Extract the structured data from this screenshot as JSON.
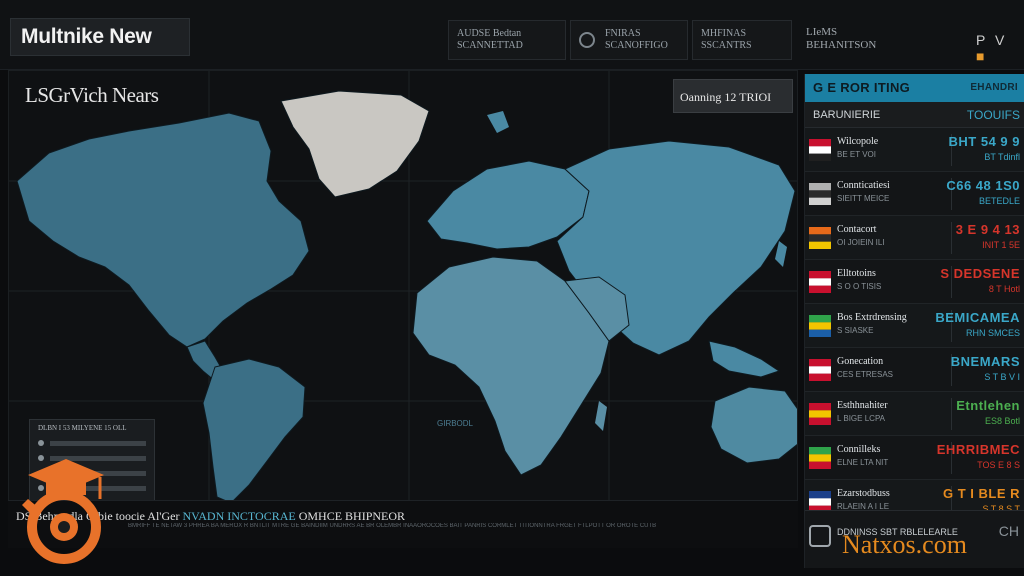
{
  "app": {
    "title": "Multnike New"
  },
  "top_tabs": [
    {
      "label": "AUDSE Bedtan\nSCANNETTAD"
    },
    {
      "label": "FNIRAS\nSCANOFFIGO"
    },
    {
      "label": "MHFINAS\nSSCANTRS"
    }
  ],
  "top_right": {
    "label": "LIeMS\nBEHANITSON",
    "pv": "P V",
    "accent": "■"
  },
  "map": {
    "title": "LSGrVich Nears",
    "badge": "Oanning 12 TRIOI",
    "center_label": "GIRBODL",
    "mini_box_header": "DLBN I 53 MILYENE 15 OLL"
  },
  "ticker": {
    "title_pre": "DS Behmadla Olbie toocie Al'Ger",
    "title_hl": "NVADN INCTOCRAE",
    "title_post": "OMHCE BHIPNEOR",
    "sub": "BMRIFF TE NETAW 3 PHREA BA MEROX R BNTLIT MTRE GE BAINDIIM UNDRRS AE BR OLEMBR INAAOROCOES BAIT PANRIS CORMLET TITIONNTRA FRGET FTLPOTT OR OROTE CUTB"
  },
  "list": {
    "header": "G E ROR ITING",
    "header_right": "EHANDRI",
    "sub_label": "BARUNIERIE",
    "sub_right": "TOOUIFS",
    "rows": [
      {
        "name": "Wilcopole",
        "meta": "BE ET VOI",
        "val": "BHT 54 9 9",
        "val2": "BT Tdinfl",
        "color": "#3aa7c8",
        "flag": [
          "#c8102e",
          "#ffffff",
          "#202020"
        ]
      },
      {
        "name": "Connticatiesi",
        "meta": "SIEITT MEICE",
        "val": "C66 48 1S0",
        "val2": "BETEDLE",
        "color": "#3aa7c8",
        "flag": [
          "#b0b0b0",
          "#2a2a2a",
          "#d0d0d0"
        ]
      },
      {
        "name": "Contacort",
        "meta": "OI JOIEIN ILI",
        "val": "3 E 9 4 13",
        "val2": "INIT 1 5E",
        "color": "#d6352b",
        "flag": [
          "#e86a1a",
          "#2b2b2b",
          "#f2c500"
        ]
      },
      {
        "name": "Elltotoins",
        "meta": "S O O TISIS",
        "val": "S DEDSENE",
        "val2": "8 T Hotl",
        "color": "#d6352b",
        "flag": [
          "#c8102e",
          "#ffffff",
          "#c8102e"
        ]
      },
      {
        "name": "Bos Extrdrensing",
        "meta": "S SIASKE",
        "val": "BEMICAMEA",
        "val2": "RHN SMCES",
        "color": "#3aa7c8",
        "flag": [
          "#2fa34a",
          "#f2c500",
          "#1b5fa8"
        ]
      },
      {
        "name": "Gonecation",
        "meta": "CES ETRESAS",
        "val": "BNEMARS",
        "val2": "S T B V I",
        "color": "#3aa7c8",
        "flag": [
          "#c8102e",
          "#ffffff",
          "#c8102e"
        ]
      },
      {
        "name": "Esthhnahiter",
        "meta": "L BIGE LCPA",
        "val": "Etntlehen",
        "val2": "ES8 Botl",
        "color": "#4caf50",
        "flag": [
          "#c8102e",
          "#f2c500",
          "#c8102e"
        ]
      },
      {
        "name": "Connilleks",
        "meta": "ELNE LTA NIT",
        "val": "EHRRIBMEC",
        "val2": "TOS E 8 S",
        "color": "#d6352b",
        "flag": [
          "#2fa34a",
          "#f2c500",
          "#c8102e"
        ]
      },
      {
        "name": "Ezarstodbuss",
        "meta": "RLAEIN A I LE",
        "val": "G T I BLE R",
        "val2": "S T 8 S T",
        "color": "#e58a1f",
        "flag": [
          "#1b3f8a",
          "#ffffff",
          "#c8102e"
        ]
      }
    ],
    "foot_text": "DDNINSS SBT RBLELEARLE",
    "foot_right": "CH"
  },
  "watermark": "Natxos.com"
}
